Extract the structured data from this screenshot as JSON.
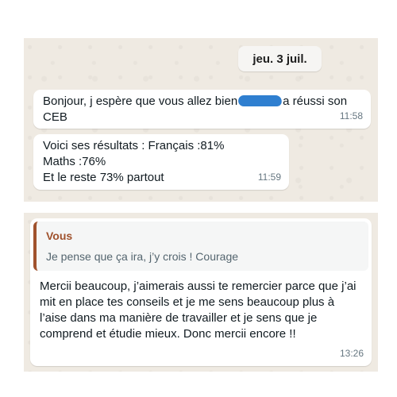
{
  "chat_top": {
    "date_chip": "jeu. 3 juil.",
    "message1": {
      "text_before": "Bonjour, j espère que vous allez bien",
      "text_after": "a réussi son CEB",
      "time": "11:58"
    },
    "message2": {
      "lines": [
        "Voici ses résultats : Français :81%",
        "Maths :76%",
        "Et le reste 73% partout"
      ],
      "time": "11:59"
    }
  },
  "chat_bottom": {
    "quote": {
      "author": "Vous",
      "text": "Je pense que ça ira, j’y crois ! Courage"
    },
    "reply": {
      "text": "Mercii beaucoup, j’aimerais aussi te remercier parce que j’ai mit en place tes conseils et je me sens beaucoup plus à l’aise dans ma manière de travailler et je sens que je comprend et étudie mieux. Donc mercii encore !!",
      "time": "13:26"
    }
  },
  "colors": {
    "chat_background": "#efeae2",
    "bubble": "#ffffff",
    "quote_accent": "#a0522d",
    "redaction": "#2f7fd0"
  }
}
